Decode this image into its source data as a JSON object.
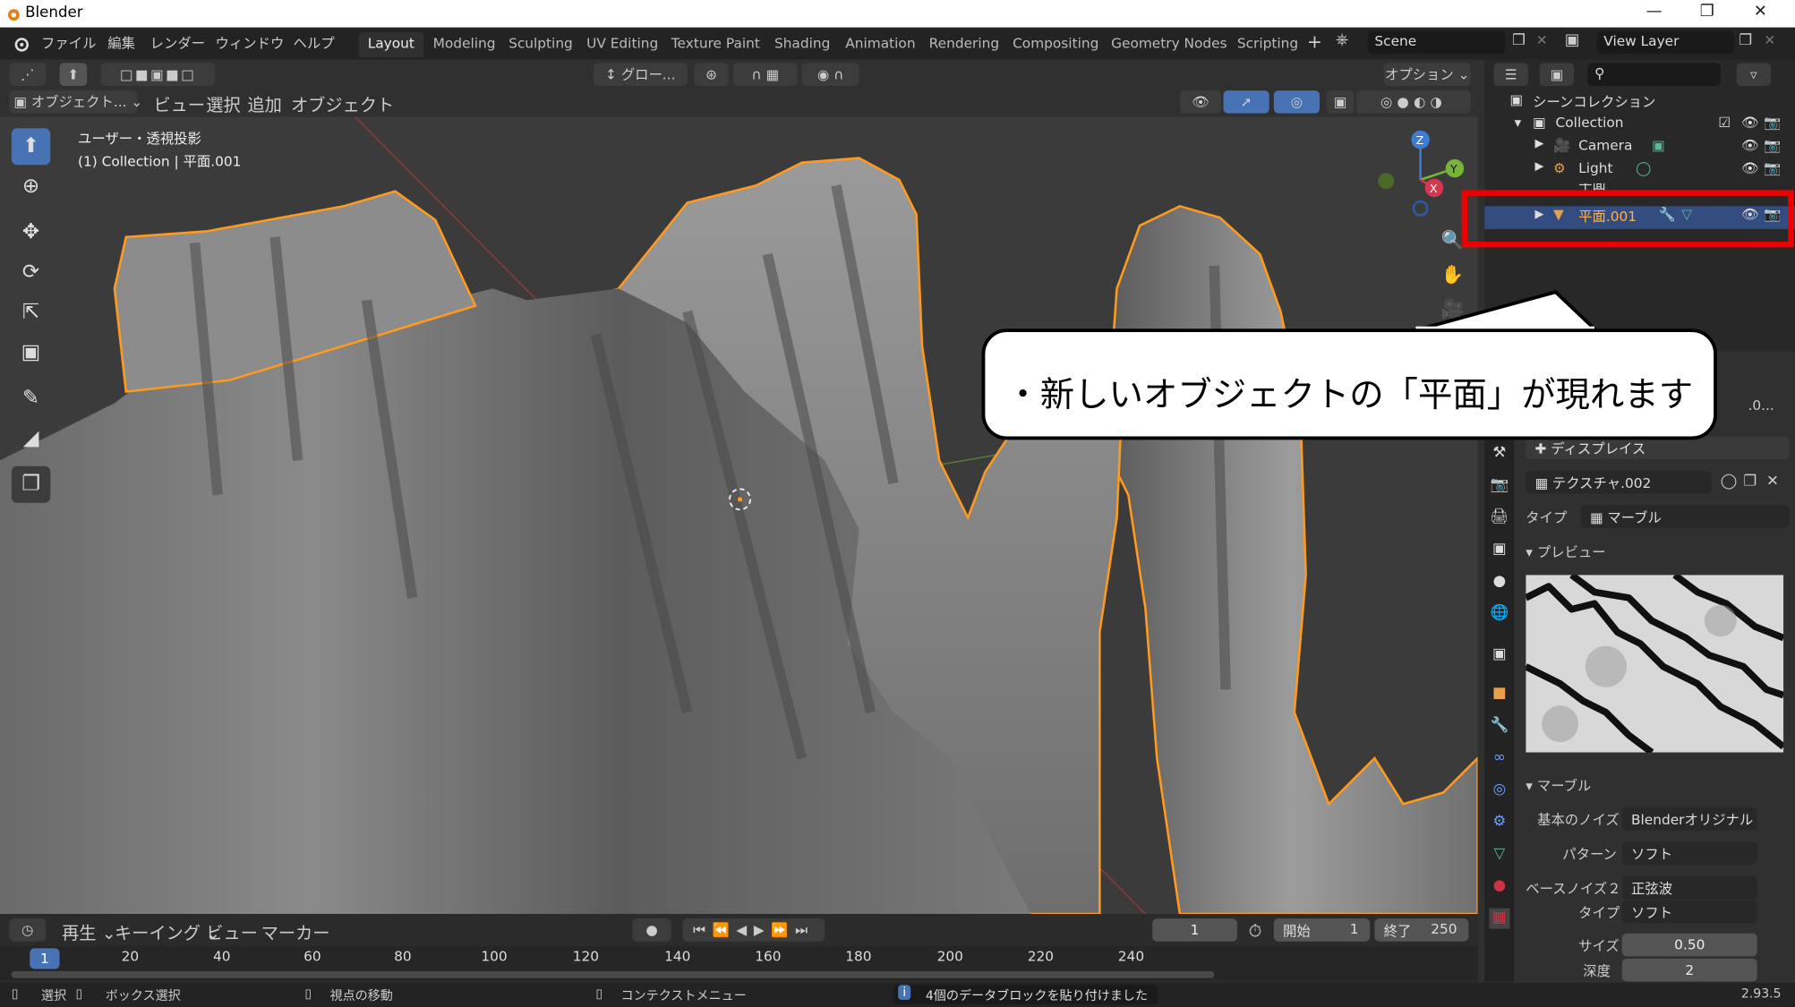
{
  "window": {
    "title": "Blender"
  },
  "menu": {
    "items": [
      "ファイル",
      "編集",
      "レンダー",
      "ウィンドウ",
      "ヘルプ"
    ]
  },
  "workspaces": [
    {
      "label": "Layout",
      "active": true
    },
    {
      "label": "Modeling"
    },
    {
      "label": "Sculpting"
    },
    {
      "label": "UV Editing"
    },
    {
      "label": "Texture Paint"
    },
    {
      "label": "Shading"
    },
    {
      "label": "Animation"
    },
    {
      "label": "Rendering"
    },
    {
      "label": "Compositing"
    },
    {
      "label": "Geometry Nodes"
    },
    {
      "label": "Scripting"
    }
  ],
  "scene": {
    "name": "Scene"
  },
  "view_layer": {
    "name": "View Layer"
  },
  "header3d": {
    "transform": "グロー...",
    "options": "オプション"
  },
  "header3d_row2": {
    "mode": "オブジェクト...",
    "view": "ビュー",
    "select": "選択",
    "add": "追加",
    "object": "オブジェクト"
  },
  "viewport": {
    "view_name": "ユーザー・透視投影",
    "collection_info": "(1) Collection | 平面.001"
  },
  "gizmo": {
    "x": "X",
    "y": "Y",
    "z": "Z"
  },
  "outliner": {
    "scene_collection": "シーンコレクション",
    "collection": "Collection",
    "items": [
      {
        "label": "Camera"
      },
      {
        "label": "Light"
      },
      {
        "label": "平面"
      },
      {
        "label": "平面.001",
        "selected": true
      }
    ]
  },
  "callout": {
    "text": "・新しいオブジェクトの「平面」が現れます"
  },
  "properties": {
    "name_truncated": ".0...",
    "panel_title": "ディスプレイス",
    "texture_name": "テクスチャ.002",
    "type_label": "タイプ",
    "type_value": "マーブル",
    "preview_title": "プレビュー",
    "marble_title": "マーブル",
    "basis_label": "基本のノイズ",
    "basis_value": "Blenderオリジナル",
    "pattern_label": "パターン",
    "pattern_value": "ソフト",
    "base2_label": "ベースノイズ２",
    "base2_value": "正弦波",
    "type2_label": "タイプ",
    "type2_value": "ソフト",
    "size_label": "サイズ",
    "size_value": "0.50",
    "depth_label": "深度",
    "depth_value": "2"
  },
  "timeline": {
    "play": "再生",
    "keying": "キーイング",
    "view": "ビュー",
    "marker": "マーカー",
    "current_frame": "1",
    "start_label": "開始",
    "start": "1",
    "end_label": "終了",
    "end": "250",
    "ticks": [
      "1",
      "20",
      "40",
      "60",
      "80",
      "100",
      "120",
      "140",
      "160",
      "180",
      "200",
      "220",
      "240"
    ]
  },
  "status": {
    "select": "選択",
    "box_select": "ボックス選択",
    "rotate_view": "視点の移動",
    "context_menu": "コンテクストメニュー",
    "message": "4個のデータブロックを貼り付けました",
    "version": "2.93.5"
  },
  "colors": {
    "accent": "#4772b3",
    "selection_outline": "#ff9a1f",
    "highlight_red": "#ee0000"
  }
}
